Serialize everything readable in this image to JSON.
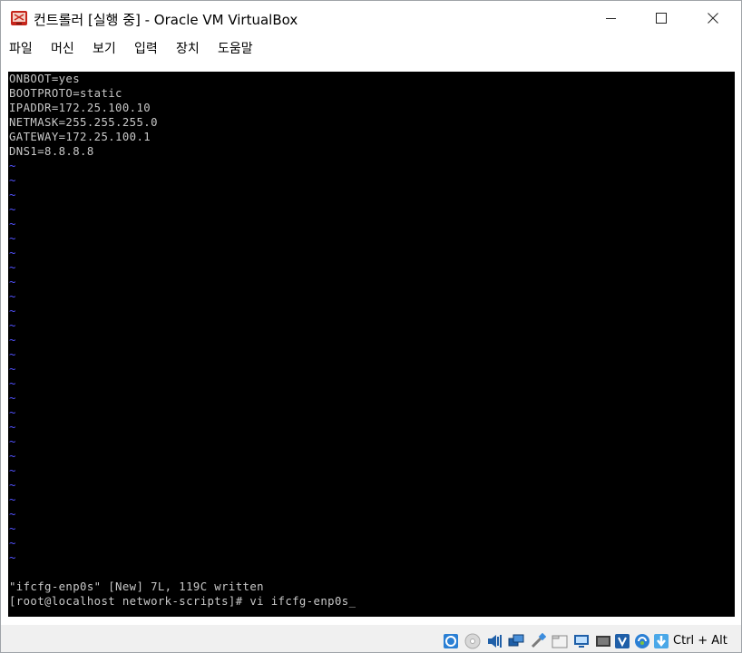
{
  "window": {
    "title": "컨트롤러 [실행 중] - Oracle VM VirtualBox"
  },
  "menu": [
    "파일",
    "머신",
    "보기",
    "입력",
    "장치",
    "도움말"
  ],
  "terminal": {
    "lines": [
      "ONBOOT=yes",
      "BOOTPROTO=static",
      "IPADDR=172.25.100.10",
      "NETMASK=255.255.255.0",
      "GATEWAY=172.25.100.1",
      "DNS1=8.8.8.8"
    ],
    "tilde_char": "~",
    "tilde_count": 28,
    "status_message": "\"ifcfg-enp0s\" [New] 7L, 119C written",
    "prompt_line": "[root@localhost network-scripts]# vi ifcfg-enp0s",
    "cursor": "_"
  },
  "statusbar": {
    "icons": [
      "hard-disk-icon",
      "optical-drive-icon",
      "audio-icon",
      "network-icon",
      "usb-icon",
      "shared-folders-icon",
      "display-icon",
      "video-capture-icon",
      "virtualization-icon",
      "mouse-integration-icon",
      "arrow-down-icon"
    ],
    "host_key": "Ctrl + Alt"
  },
  "colors": {
    "terminal_bg": "#000000",
    "terminal_fg": "#c8c8c8",
    "tilde": "#5252ff"
  }
}
